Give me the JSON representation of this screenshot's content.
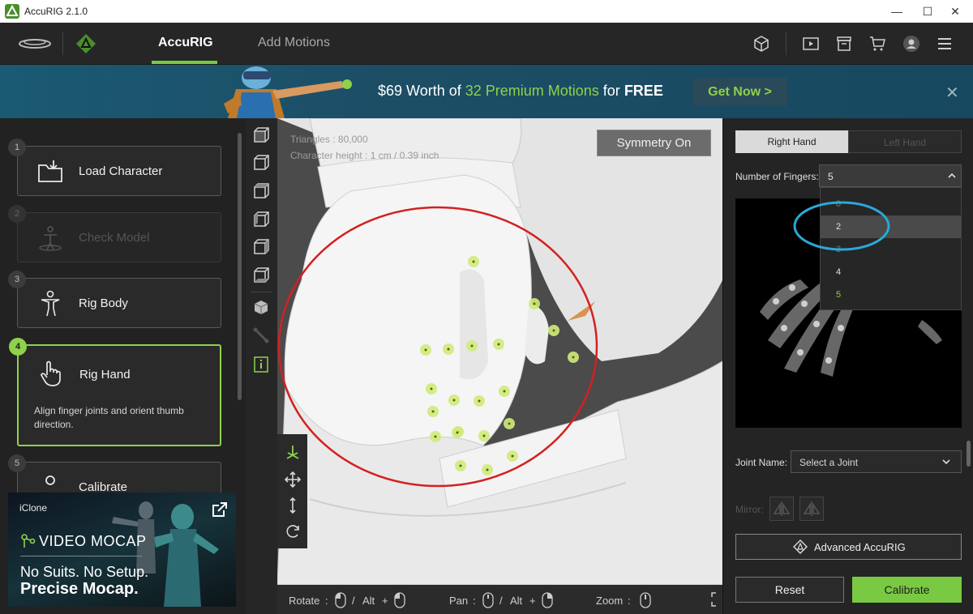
{
  "window": {
    "title": "AccuRIG 2.1.0"
  },
  "header": {
    "tabs": [
      {
        "label": "AccuRIG",
        "active": true
      },
      {
        "label": "Add Motions",
        "active": false
      }
    ],
    "icons": [
      "cube-icon",
      "play-icon",
      "archive-icon",
      "cart-icon",
      "user-icon",
      "menu-icon"
    ]
  },
  "banner": {
    "price": "$69 Worth of ",
    "highlight": "32 Premium Motions",
    "for": " for ",
    "free": "FREE",
    "cta": "Get Now >"
  },
  "steps": [
    {
      "num": "1",
      "label": "Load Character",
      "icon": "load-icon",
      "state": "enabled"
    },
    {
      "num": "2",
      "label": "Check Model",
      "icon": "check-model-icon",
      "state": "disabled"
    },
    {
      "num": "3",
      "label": "Rig Body",
      "icon": "body-icon",
      "state": "enabled"
    },
    {
      "num": "4",
      "label": "Rig Hand",
      "icon": "hand-icon",
      "state": "active",
      "desc": "Align finger joints and orient thumb direction."
    },
    {
      "num": "5",
      "label": "Calibrate",
      "icon": "calibrate-icon",
      "state": "enabled"
    }
  ],
  "ad": {
    "brand": "iClone",
    "headline": "VIDEO MOCAP",
    "line1": "No Suits. No Setup.",
    "line2": "Precise Mocap."
  },
  "viewport": {
    "stats_line1": "Triangles : 80,000",
    "stats_line2": "Character height : 1 cm / 0.39 inch",
    "symmetry": "Symmetry On",
    "hints": {
      "rotate": "Rotate",
      "pan": "Pan",
      "zoom": "Zoom",
      "sep": ":",
      "slash": "/",
      "alt": "Alt",
      "plus": "+"
    }
  },
  "right_panel": {
    "hand_tabs": [
      "Right Hand",
      "Left Hand"
    ],
    "fingers_label": "Number of Fingers:",
    "fingers_value": "5",
    "finger_options": [
      "0",
      "2",
      "3",
      "4",
      "5"
    ],
    "finger_hover": "2",
    "joint_label": "Joint Name:",
    "joint_placeholder": "Select a Joint",
    "mirror_label": "Mirror:",
    "advanced": "Advanced AccuRIG",
    "reset": "Reset",
    "calibrate": "Calibrate"
  },
  "colors": {
    "accent": "#7ac943",
    "banner": "#1c4e66",
    "highlight_circle": "#d42020",
    "hover_ring": "#2aa8d8"
  }
}
